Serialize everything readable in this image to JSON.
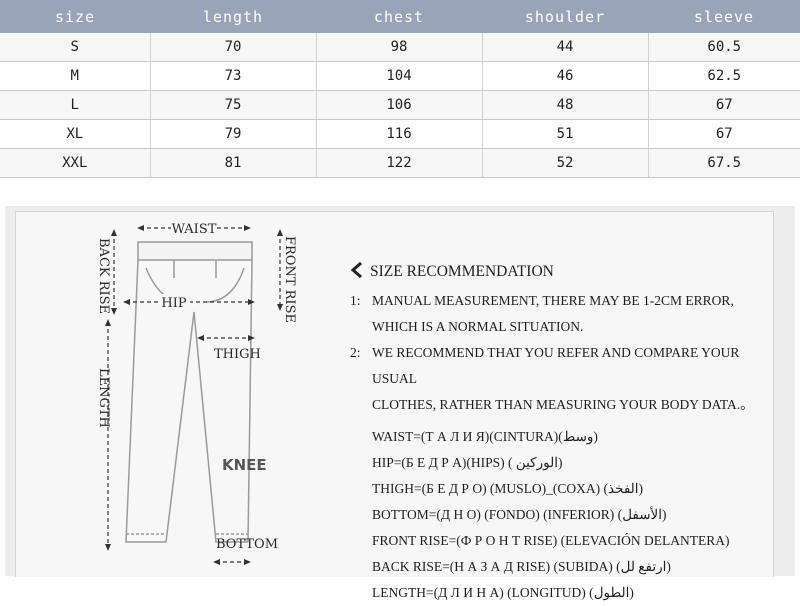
{
  "size_table": {
    "headers": [
      "size",
      "length",
      "chest",
      "shoulder",
      "sleeve"
    ],
    "rows": [
      [
        "S",
        "70",
        "98",
        "44",
        "60.5"
      ],
      [
        "M",
        "73",
        "104",
        "46",
        "62.5"
      ],
      [
        "L",
        "75",
        "106",
        "48",
        "67"
      ],
      [
        "XL",
        "79",
        "116",
        "51",
        "67"
      ],
      [
        "XXL",
        "81",
        "122",
        "52",
        "67.5"
      ]
    ]
  },
  "diagram": {
    "waist": "WAIST",
    "front_rise": "FRONT RISE",
    "back_rise": "BACK RISE",
    "hip": "HIP",
    "thigh": "THIGH",
    "length": "LENGTH",
    "knee": "KNEE",
    "bottom": "BOTTOM"
  },
  "recommendation": {
    "title": "SIZE RECOMMENDATION",
    "notes": [
      {
        "num": "1:",
        "lines": [
          "MANUAL MEASUREMENT, THERE MAY BE 1-2CM ERROR,",
          "WHICH IS A NORMAL SITUATION."
        ]
      },
      {
        "num": "2:",
        "lines": [
          "WE RECOMMEND THAT YOU REFER AND COMPARE YOUR USUAL",
          "CLOTHES, RATHER THAN MEASURING YOUR BODY DATA.。"
        ]
      }
    ],
    "measurements": [
      "WAIST=(Т А Л И Я)(CINTURA)(وسط)",
      "HIP=(Б Е Д Р А)(HIPS) ( الوركين)",
      "THIGH=(Б Е Д Р О) (MUSLO)_(COXA) (الفخذ)",
      "BOTTOM=(Д Н О) (FONDO) (INFERIOR) (الأسفل)",
      "FRONT RISE=(Ф Р О Н Т RISE) (ELEVACIÓN DELANTERA)",
      "BACK RISE=(Н А З А Д RISE) (SUBIDA) (ارتفع لل)",
      "LENGTH=(Д Л И Н А) (LONGITUD) (الطول)"
    ]
  },
  "icons": {
    "back": "chevron-left-icon"
  },
  "colors": {
    "header_bg": "#99a4b8",
    "panel_bg": "#ededed"
  }
}
